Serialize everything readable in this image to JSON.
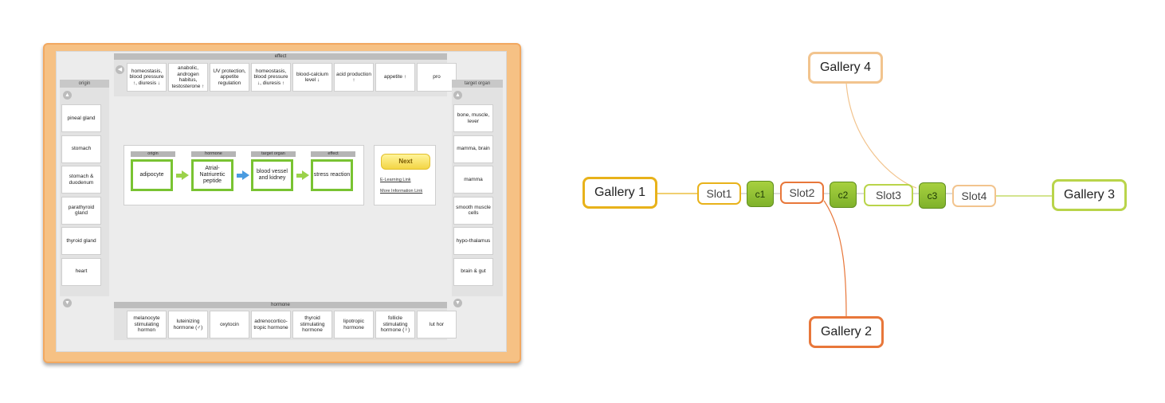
{
  "app": {
    "effect_header": "effect",
    "origin_header": "origin",
    "target_header": "target organ",
    "hormone_header": "hormone",
    "effect_items": [
      "homeostasis, blood pressure ↑, diuresis ↓",
      "anabolic, androgen habitus, testosterone ↑",
      "UV protection, appetite regulation",
      "homeostasis, blood pressure ↓, diuresis ↑",
      "blood-calcium level ↓",
      "acid production ↑",
      "appetite ↑",
      "pro"
    ],
    "origin_items": [
      "pineal gland",
      "stomach",
      "stomach & duodenum",
      "parathyroid gland",
      "thyroid gland",
      "heart"
    ],
    "target_items": [
      "bone, muscle, lever",
      "mamma, brain",
      "mamma",
      "smooth muscle cells",
      "hypo-thalamus",
      "brain & gut"
    ],
    "hormone_items": [
      "melanocyte stimulating hormon",
      "luteinizing hormone (♂)",
      "oxytocin",
      "adrenocortico-tropic hormone",
      "thyroid stimulating hormone",
      "lipotropic hormone",
      "follicle stimulating hormone (♀)",
      "lut hor"
    ],
    "chain": {
      "headers": [
        "origin",
        "hormone",
        "target organ",
        "effect"
      ],
      "values": [
        "adipocyte",
        "Atrial-Natriuretic peptide",
        "blood vessel and kidney",
        "stress reaction"
      ]
    },
    "next_label": "Next",
    "elearning_link": "E-Learning Link",
    "more_info_link": "More Information Link",
    "icons": {
      "left": "chevron-left-icon",
      "right": "chevron-right-icon",
      "up": "chevron-up-icon",
      "down": "chevron-down-icon"
    }
  },
  "mindmap": {
    "galleries": [
      "Gallery 1",
      "Gallery 2",
      "Gallery 3",
      "Gallery 4"
    ],
    "slots": [
      "Slot1",
      "Slot2",
      "Slot3",
      "Slot4"
    ],
    "connectors": [
      "c1",
      "c2",
      "c3"
    ],
    "colors": {
      "gallery1": "#e8b21a",
      "gallery2": "#e8773a",
      "gallery3": "#b9d44a",
      "gallery4": "#f2c48e",
      "connector_fill": "#93c23a",
      "green_card": "#79c332",
      "frame_orange": "#f6c184"
    }
  }
}
